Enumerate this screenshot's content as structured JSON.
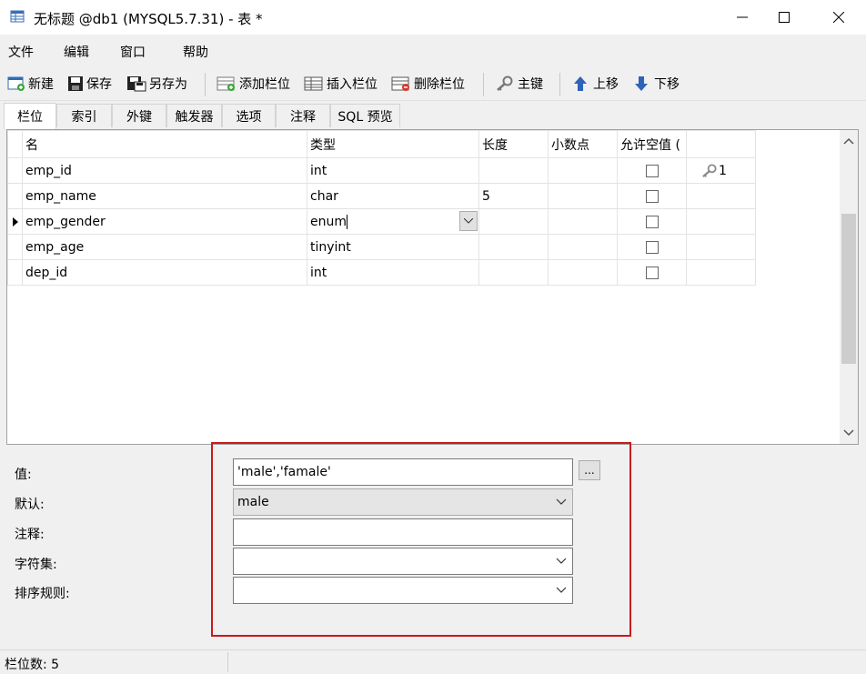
{
  "window": {
    "title": "无标题 @db1 (MYSQL5.7.31) - 表 *"
  },
  "menu": [
    "文件",
    "编辑",
    "窗口",
    "帮助"
  ],
  "toolbar": {
    "new": "新建",
    "save": "保存",
    "save_as": "另存为",
    "add_field": "添加栏位",
    "insert_field": "插入栏位",
    "delete_field": "删除栏位",
    "primary_key": "主键",
    "move_up": "上移",
    "move_down": "下移"
  },
  "tabs": [
    "栏位",
    "索引",
    "外键",
    "触发器",
    "选项",
    "注释",
    "SQL 预览"
  ],
  "grid": {
    "headers": [
      "名",
      "类型",
      "长度",
      "小数点",
      "允许空值 (",
      ""
    ],
    "rows": [
      {
        "name": "emp_id",
        "type": "int",
        "length": "",
        "decimals": "",
        "pk": "1"
      },
      {
        "name": "emp_name",
        "type": "char",
        "length": "5",
        "decimals": "",
        "pk": ""
      },
      {
        "name": "emp_gender",
        "type": "enum",
        "length": "",
        "decimals": "",
        "pk": ""
      },
      {
        "name": "emp_age",
        "type": "tinyint",
        "length": "",
        "decimals": "",
        "pk": ""
      },
      {
        "name": "dep_id",
        "type": "int",
        "length": "",
        "decimals": "",
        "pk": ""
      }
    ]
  },
  "props": {
    "value_label": "值:",
    "value": "'male','famale'",
    "more_btn": "...",
    "default_label": "默认:",
    "default_value": "male",
    "comment_label": "注释:",
    "comment_value": "",
    "charset_label": "字符集:",
    "charset_value": "",
    "collation_label": "排序规则:",
    "collation_value": ""
  },
  "status": {
    "field_count": "栏位数: 5"
  },
  "colors": {
    "highlight_border": "#c81b1b",
    "key_icon": "#8a8a8a"
  }
}
